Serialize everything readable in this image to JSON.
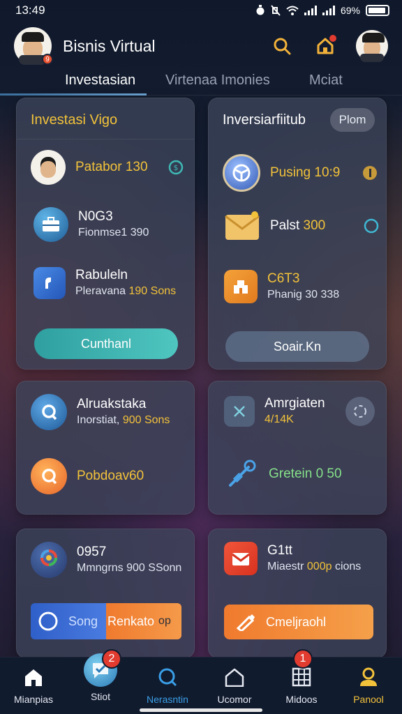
{
  "status": {
    "time": "13:49",
    "battery": "69%"
  },
  "header": {
    "title": "Bisnis Virtual",
    "avatar_badge": "9"
  },
  "tabs": [
    {
      "label": "Investasian"
    },
    {
      "label": "Virtenaa Imonies"
    },
    {
      "label": "Mciat"
    }
  ],
  "card1": {
    "title": "Investasi Vigo",
    "rows": [
      {
        "title": "Patabor 130"
      },
      {
        "title": "N0G3",
        "sub": "Fionmse1 390"
      },
      {
        "title": "Rabuleln",
        "sub_prefix": "Pleravana ",
        "sub_gold": "190 Sons"
      }
    ],
    "button": "Cunthanl"
  },
  "card2": {
    "title": "Inversiarfiitub",
    "chip": "Plom",
    "rows": [
      {
        "title": "Pusing 10:9"
      },
      {
        "title": "Palst ",
        "title_gold": "300"
      },
      {
        "title": "C6T3",
        "sub": "Phanig 30 338"
      }
    ],
    "button": "Soair.Kn"
  },
  "card3": {
    "rows": [
      {
        "title": "Alruakstaka",
        "sub_prefix": "Inorstiat, ",
        "sub_gold": "900 Sons"
      },
      {
        "title": "Pobdoav60"
      }
    ]
  },
  "card4": {
    "rows": [
      {
        "title": "Amrgiaten",
        "sub": "4/14K"
      },
      {
        "title": "Gretein 0 50"
      }
    ]
  },
  "card5": {
    "rows": [
      {
        "title": "0957",
        "sub": "Mmngrns 900 SSonn"
      }
    ],
    "button_left": "Song",
    "button_right": "Renkato",
    "button_suffix": "op"
  },
  "card6": {
    "rows": [
      {
        "title": "G1tt",
        "sub_prefix": "Miaestr ",
        "sub_gold": "000p",
        "sub_suffix": " cions"
      }
    ],
    "button": "Cmeljraohl"
  },
  "nav": [
    {
      "label": "Mianpias",
      "icon": "home-icon"
    },
    {
      "label": "Stiot",
      "icon": "chat-icon",
      "badge": "2"
    },
    {
      "label": "Nerasntin",
      "icon": "search-icon"
    },
    {
      "label": "Ucomor",
      "icon": "house-outline-icon"
    },
    {
      "label": "Midoos",
      "icon": "grid-icon",
      "badge": "1"
    },
    {
      "label": "Panool",
      "icon": "profile-icon"
    }
  ],
  "colors": {
    "accent_teal": "#3fb8b4",
    "accent_gold": "#f2c23a",
    "accent_orange": "#f07a2e",
    "nav_active": "#3aa0e8"
  }
}
